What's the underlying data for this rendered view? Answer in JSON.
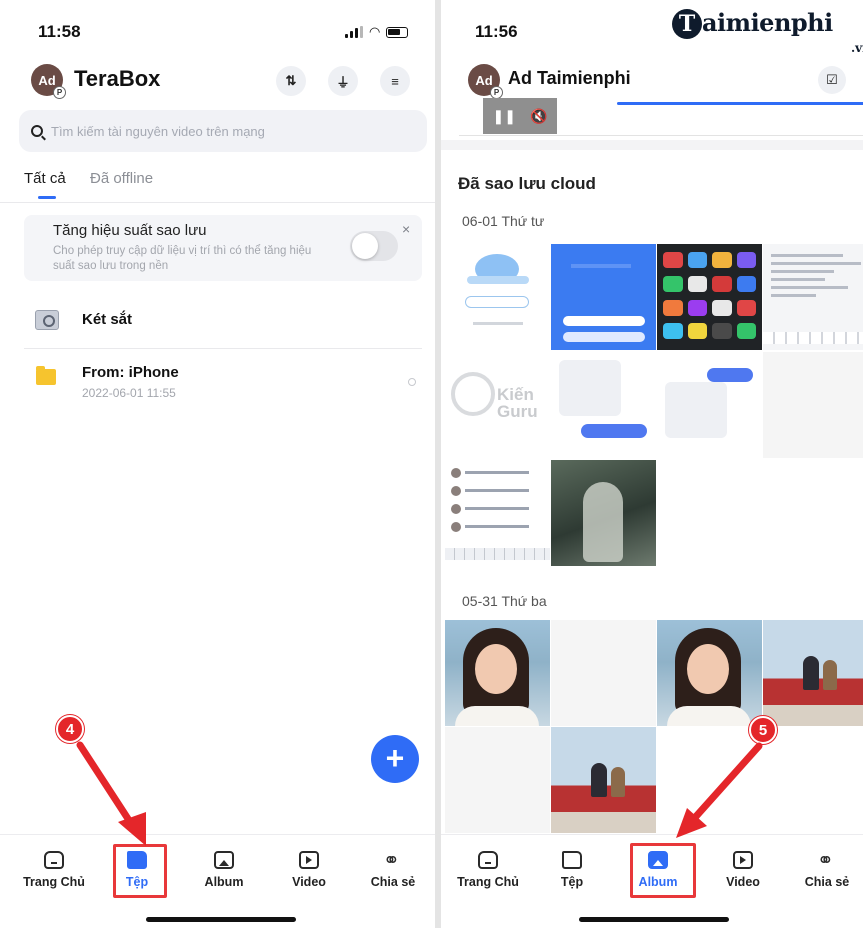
{
  "left": {
    "status_time": "11:58",
    "avatar_initials": "Ad",
    "avatar_badge": "P",
    "app_title": "TeraBox",
    "header_icons": [
      "sort-icon",
      "filter-icon",
      "list-icon"
    ],
    "header_glyphs": {
      "sort": "⇅",
      "filter": "⏚",
      "list": "≡"
    },
    "search_placeholder": "Tìm kiếm tài nguyên video trên mạng",
    "tabs": [
      {
        "label": "Tất cả"
      },
      {
        "label": "Đã offline"
      }
    ],
    "backup_card": {
      "title": "Tăng hiệu suất sao lưu",
      "description": "Cho phép truy cập dữ liệu vị trí thì có thể tăng hiệu suất sao lưu trong nền",
      "close_glyph": "×"
    },
    "files": [
      {
        "name": "Két sắt",
        "date": ""
      },
      {
        "name": "From: iPhone",
        "date": "2022-06-01 11:55"
      }
    ],
    "fab_glyph": "+",
    "nav": [
      {
        "label": "Trang Chủ"
      },
      {
        "label": "Tệp"
      },
      {
        "label": "Album"
      },
      {
        "label": "Video"
      },
      {
        "label": "Chia sẻ"
      }
    ],
    "step_badge": "4"
  },
  "right": {
    "status_time": "11:56",
    "watermark_letter": "T",
    "watermark_text": "aimienphi",
    "watermark_sub": ".vn",
    "avatar_initials": "Ad",
    "avatar_badge": "P",
    "user_name": "Ad Taimienphi",
    "header_glyph": "☑",
    "video_controls": {
      "pause": "❚❚",
      "mute": "🔇"
    },
    "cloud_title": "Đã sao lưu cloud",
    "dates": [
      "06-01 Thứ tư",
      "05-31 Thứ ba"
    ],
    "kien_guru_text": "Kiến Guru",
    "nav": [
      {
        "label": "Trang Chủ"
      },
      {
        "label": "Tệp"
      },
      {
        "label": "Album"
      },
      {
        "label": "Video"
      },
      {
        "label": "Chia sẻ"
      }
    ],
    "step_badge": "5"
  },
  "colors": {
    "accent": "#2f6cf6",
    "annotation_red": "#e4262a",
    "folder_yellow": "#f6c42e"
  }
}
